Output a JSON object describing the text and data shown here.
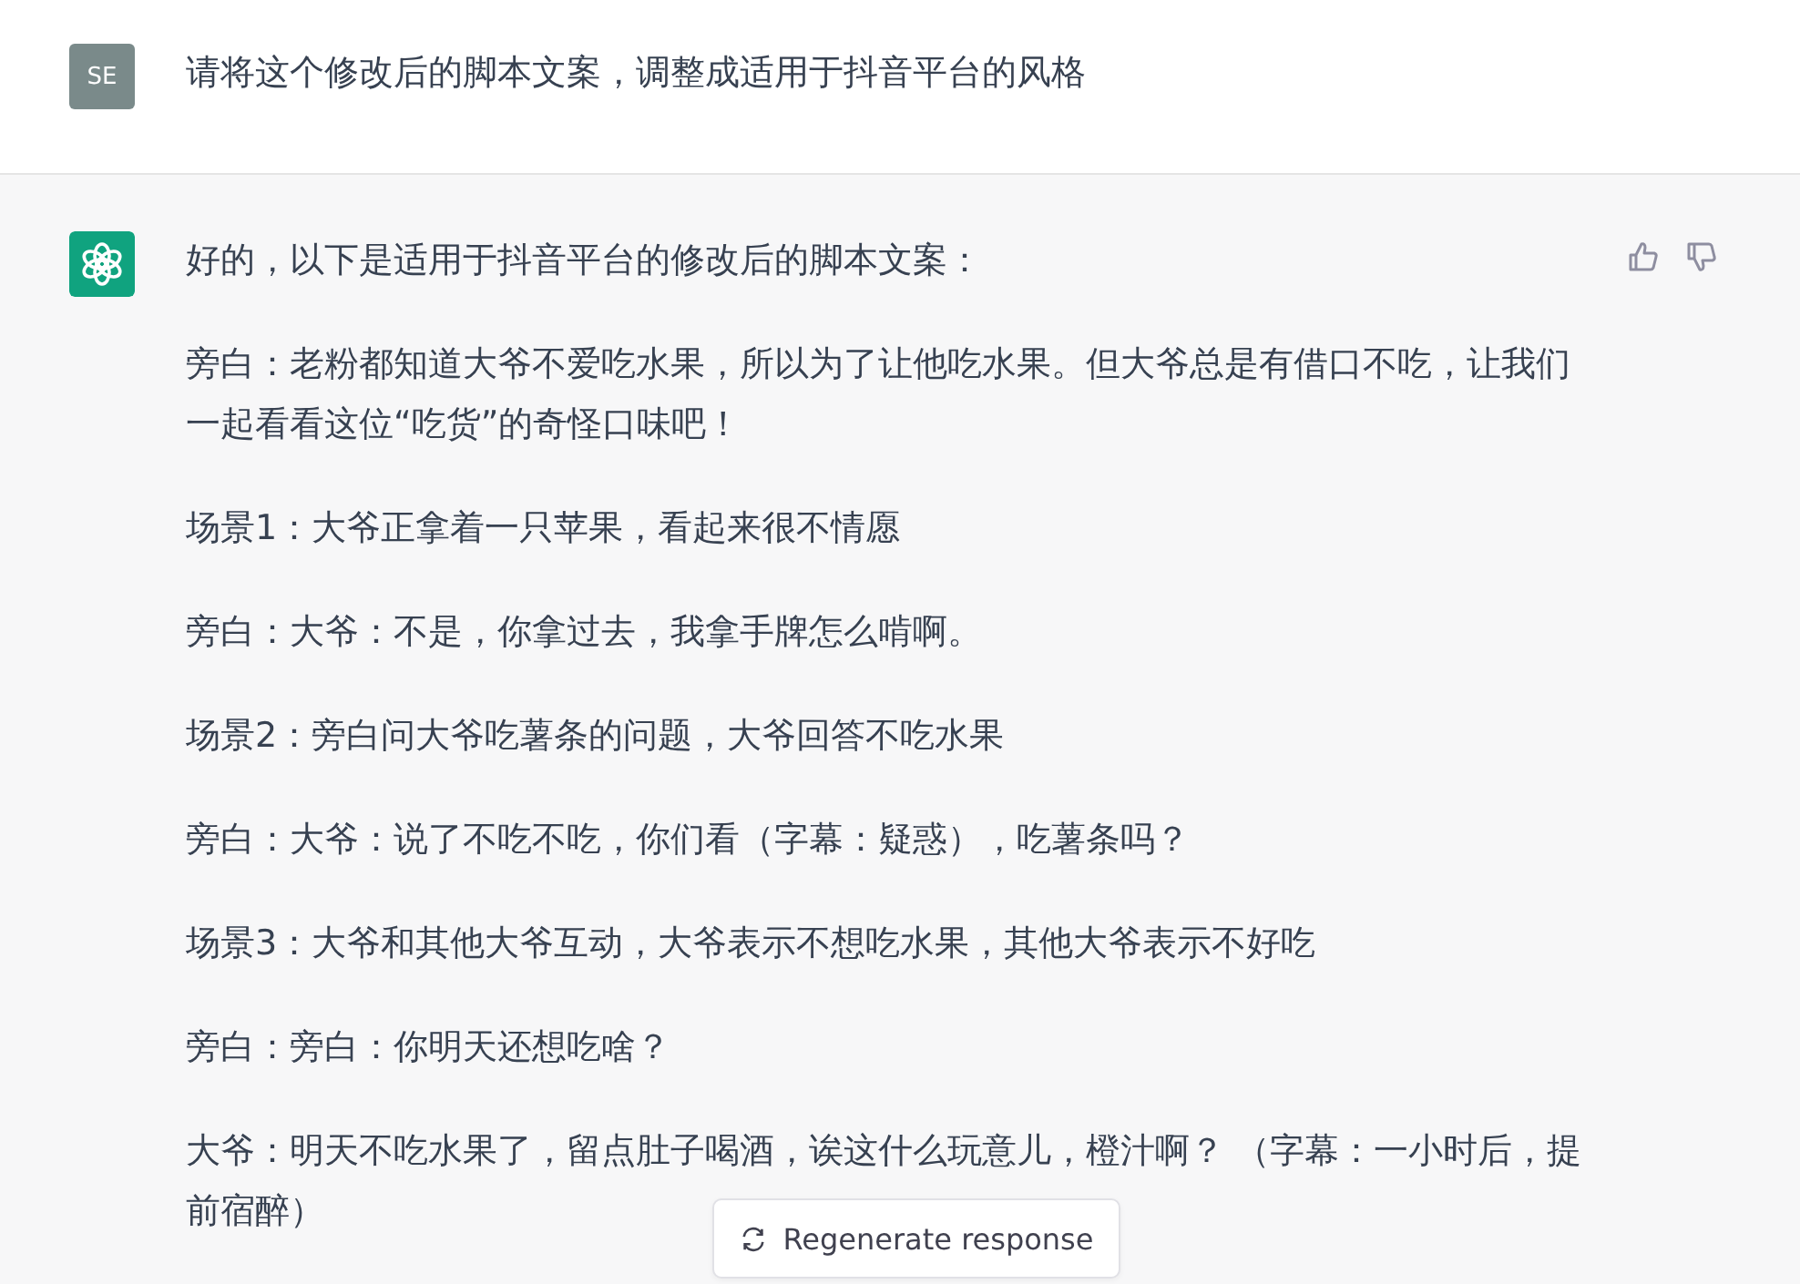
{
  "user_message": {
    "avatar": "SE",
    "text": "请将这个修改后的脚本文案，调整成适用于抖音平台的风格"
  },
  "assistant_message": {
    "paragraphs": [
      {
        "lines": [
          "好的，以下是适用于抖音平台的修改后的脚本文案："
        ]
      },
      {
        "lines": [
          "旁白：老粉都知道大爷不爱吃水果，所以为了让他吃水果。但大爷总是有借口不吃，让我们",
          "一起看看这位“吃货”的奇怪口味吧！"
        ]
      },
      {
        "lines": [
          "场景1：大爷正拿着一只苹果，看起来很不情愿"
        ]
      },
      {
        "lines": [
          "旁白：大爷：不是，你拿过去，我拿手牌怎么啃啊。"
        ]
      },
      {
        "lines": [
          "场景2：旁白问大爷吃薯条的问题，大爷回答不吃水果"
        ]
      },
      {
        "lines": [
          "旁白：大爷：说了不吃不吃，你们看（字幕：疑惑），吃薯条吗？"
        ]
      },
      {
        "lines": [
          "场景3：大爷和其他大爷互动，大爷表示不想吃水果，其他大爷表示不好吃"
        ]
      },
      {
        "lines": [
          "旁白：旁白：你明天还想吃啥？"
        ]
      },
      {
        "lines": [
          "大爷：明天不吃水果了，留点肚子喝酒，诶这什么玩意儿，橙汁啊？ （字幕：一小时后，提",
          "前宿醉）"
        ]
      }
    ]
  },
  "regenerate_button": {
    "label": "Regenerate response"
  }
}
